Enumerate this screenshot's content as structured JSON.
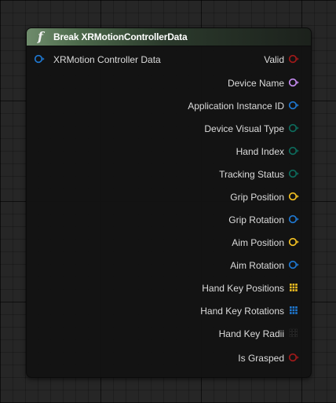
{
  "node": {
    "icon": "function-icon",
    "title": "Break XRMotionControllerData"
  },
  "input_pins": [
    {
      "label": "XRMotion Controller Data",
      "type": "struct",
      "color": "#1f78d1"
    }
  ],
  "output_pins": [
    {
      "label": "Valid",
      "type": "bool",
      "color": "#a11a1a"
    },
    {
      "label": "Device Name",
      "type": "name",
      "color": "#c58bf0"
    },
    {
      "label": "Application Instance ID",
      "type": "struct",
      "color": "#1f78d1"
    },
    {
      "label": "Device Visual Type",
      "type": "enum",
      "color": "#0d6b5c"
    },
    {
      "label": "Hand Index",
      "type": "enum",
      "color": "#0d6b5c"
    },
    {
      "label": "Tracking Status",
      "type": "enum",
      "color": "#0d6b5c"
    },
    {
      "label": "Grip Position",
      "type": "vector",
      "color": "#f3c022"
    },
    {
      "label": "Grip Rotation",
      "type": "struct",
      "color": "#1f78d1"
    },
    {
      "label": "Aim Position",
      "type": "vector",
      "color": "#f3c022"
    },
    {
      "label": "Aim Rotation",
      "type": "struct",
      "color": "#1f78d1"
    },
    {
      "label": "Hand Key Positions",
      "type": "vector-array",
      "color": "#f3c022"
    },
    {
      "label": "Hand Key Rotations",
      "type": "struct-array",
      "color": "#1f78d1"
    },
    {
      "label": "Hand Key Radii",
      "type": "float-array",
      "color": "#0f0f0f"
    },
    {
      "label": "Is Grasped",
      "type": "bool",
      "color": "#a11a1a"
    }
  ]
}
